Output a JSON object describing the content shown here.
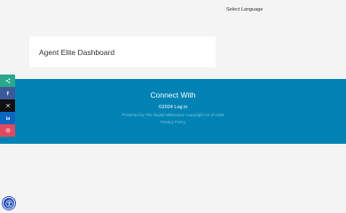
{
  "header": {
    "language_selector_label": "Select Language"
  },
  "card": {
    "title": "Agent Elite Dashboard"
  },
  "footer": {
    "heading": "Connect With",
    "copyright_year": "©2024",
    "login_link": "Log in",
    "protected_text": "Protected by The Digital Millennium Copyright Act of 1998",
    "privacy_link": "Privacy Policy",
    "background_color": "#0083b4"
  },
  "share_bar": {
    "buttons": [
      {
        "name": "share",
        "icon": "share-icon",
        "color": "#2aa88b"
      },
      {
        "name": "facebook",
        "icon": "facebook-icon",
        "color": "#3b5998"
      },
      {
        "name": "x",
        "icon": "x-icon",
        "color": "#111111"
      },
      {
        "name": "linkedin",
        "icon": "linkedin-icon",
        "color": "#0a66c2"
      },
      {
        "name": "pinterest",
        "icon": "pinterest-icon",
        "color": "#e04a5f"
      }
    ]
  },
  "accessibility": {
    "icon": "accessibility-icon",
    "color": "#1a47b8"
  }
}
